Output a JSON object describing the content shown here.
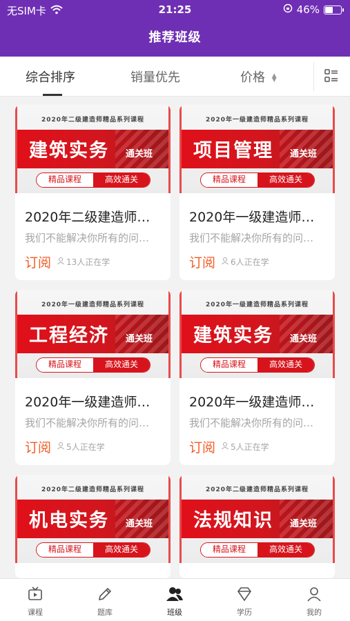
{
  "status_bar": {
    "carrier": "无SIM卡",
    "time": "21:25",
    "battery": "46%"
  },
  "header": {
    "title": "推荐班级"
  },
  "tabs": [
    {
      "label": "综合排序",
      "active": true
    },
    {
      "label": "销量优先",
      "active": false
    },
    {
      "label": "价格",
      "active": false
    }
  ],
  "icons": {
    "wifi": "wifi-icon",
    "grid": "grid-list-icon",
    "learners": "people-icon"
  },
  "cards": [
    {
      "banner_header": "2020年二级建造师精品系列课程",
      "banner_title": "建筑实务",
      "banner_tag": "通关班",
      "pill_left": "精品课程",
      "pill_right": "高效通关",
      "title": "2020年二级建造师…",
      "desc": "我们不能解决你所有的问…",
      "subscribe": "订阅",
      "learners": "13人正在学"
    },
    {
      "banner_header": "2020年一级建造师精品系列课程",
      "banner_title": "项目管理",
      "banner_tag": "通关班",
      "pill_left": "精品课程",
      "pill_right": "高效通关",
      "title": "2020年一级建造师…",
      "desc": "我们不能解决你所有的问…",
      "subscribe": "订阅",
      "learners": "6人正在学"
    },
    {
      "banner_header": "2020年一级建造师精品系列课程",
      "banner_title": "工程经济",
      "banner_tag": "通关班",
      "pill_left": "精品课程",
      "pill_right": "高效通关",
      "title": "2020年一级建造师…",
      "desc": "我们不能解决你所有的问…",
      "subscribe": "订阅",
      "learners": "5人正在学"
    },
    {
      "banner_header": "2020年一级建造师精品系列课程",
      "banner_title": "建筑实务",
      "banner_tag": "通关班",
      "pill_left": "精品课程",
      "pill_right": "高效通关",
      "title": "2020年一级建造师…",
      "desc": "我们不能解决你所有的问…",
      "subscribe": "订阅",
      "learners": "5人正在学"
    },
    {
      "banner_header": "2020年二级建造师精品系列课程",
      "banner_title": "机电实务",
      "banner_tag": "通关班",
      "pill_left": "精品课程",
      "pill_right": "高效通关",
      "title": "",
      "desc": "",
      "subscribe": "",
      "learners": ""
    },
    {
      "banner_header": "2020年二级建造师精品系列课程",
      "banner_title": "法规知识",
      "banner_tag": "通关班",
      "pill_left": "精品课程",
      "pill_right": "高效通关",
      "title": "",
      "desc": "",
      "subscribe": "",
      "learners": ""
    }
  ],
  "bottom_nav": [
    {
      "label": "课程",
      "icon": "tv-icon",
      "active": false
    },
    {
      "label": "题库",
      "icon": "pencil-icon",
      "active": false
    },
    {
      "label": "班级",
      "icon": "class-users-icon",
      "active": true
    },
    {
      "label": "学历",
      "icon": "diamond-icon",
      "active": false
    },
    {
      "label": "我的",
      "icon": "user-icon",
      "active": false
    }
  ],
  "colors": {
    "primary": "#6f2fb4",
    "accent_red": "#d7141c",
    "subscribe_orange": "#f25b24"
  }
}
